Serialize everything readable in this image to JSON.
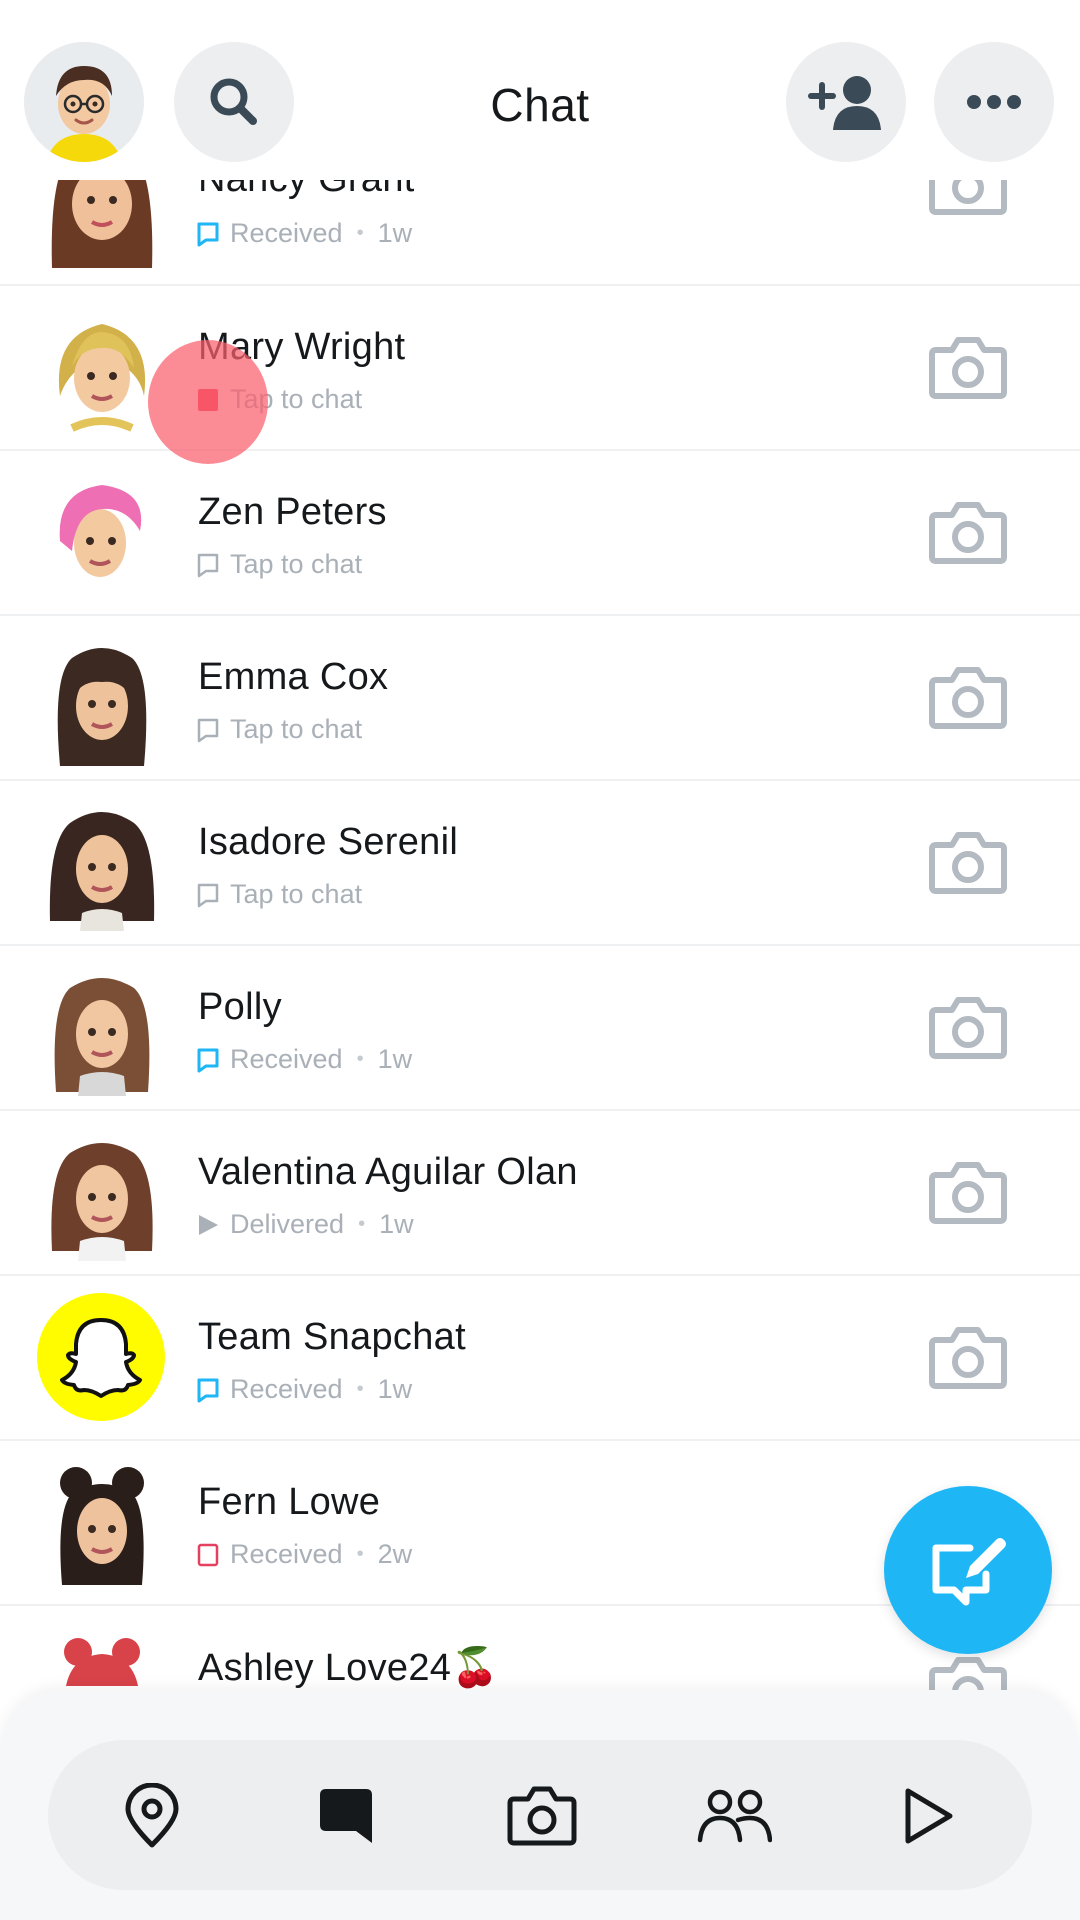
{
  "header": {
    "title": "Chat",
    "avatar_icon": "bitmoji-avatar",
    "search_icon": "search-icon",
    "add_friend_icon": "add-friend-icon",
    "more_icon": "more-icon"
  },
  "colors": {
    "accent": "#1eb6f5",
    "received_blue": "#1eb6f5",
    "new_chat_red": "#f23c57",
    "unread_red": "#e4405f",
    "muted_text": "#a9b0b7",
    "tap_indicator": "#fa606e"
  },
  "chats": [
    {
      "name": "Nancy Grant",
      "status": "Received",
      "time": "1w",
      "status_icon": "received-chat-icon"
    },
    {
      "name": "Mary Wright",
      "status": "Tap to chat",
      "time": "",
      "status_icon": "new-chat-icon"
    },
    {
      "name": "Zen Peters",
      "status": "Tap to chat",
      "time": "",
      "status_icon": "chat-outline-icon"
    },
    {
      "name": "Emma Cox",
      "status": "Tap to chat",
      "time": "",
      "status_icon": "chat-outline-icon"
    },
    {
      "name": "Isadore Serenil",
      "status": "Tap to chat",
      "time": "",
      "status_icon": "chat-outline-icon"
    },
    {
      "name": "Polly",
      "status": "Received",
      "time": "1w",
      "status_icon": "received-chat-icon"
    },
    {
      "name": "Valentina Aguilar Olan",
      "status": "Delivered",
      "time": "1w",
      "status_icon": "delivered-arrow-icon"
    },
    {
      "name": "Team Snapchat",
      "status": "Received",
      "time": "1w",
      "status_icon": "received-chat-icon"
    },
    {
      "name": "Fern Lowe",
      "status": "Received",
      "time": "2w",
      "status_icon": "received-snap-icon"
    },
    {
      "name": "Ashley Love24🍒",
      "status": "",
      "time": "",
      "status_icon": ""
    }
  ],
  "fab": {
    "icon": "new-chat-compose-icon"
  },
  "bottom_nav": [
    {
      "label": "Map",
      "icon": "map-pin-icon"
    },
    {
      "label": "Chat",
      "icon": "chat-icon",
      "active": true
    },
    {
      "label": "Camera",
      "icon": "camera-icon"
    },
    {
      "label": "Stories",
      "icon": "friends-icon"
    },
    {
      "label": "Spotlight",
      "icon": "play-icon"
    }
  ]
}
